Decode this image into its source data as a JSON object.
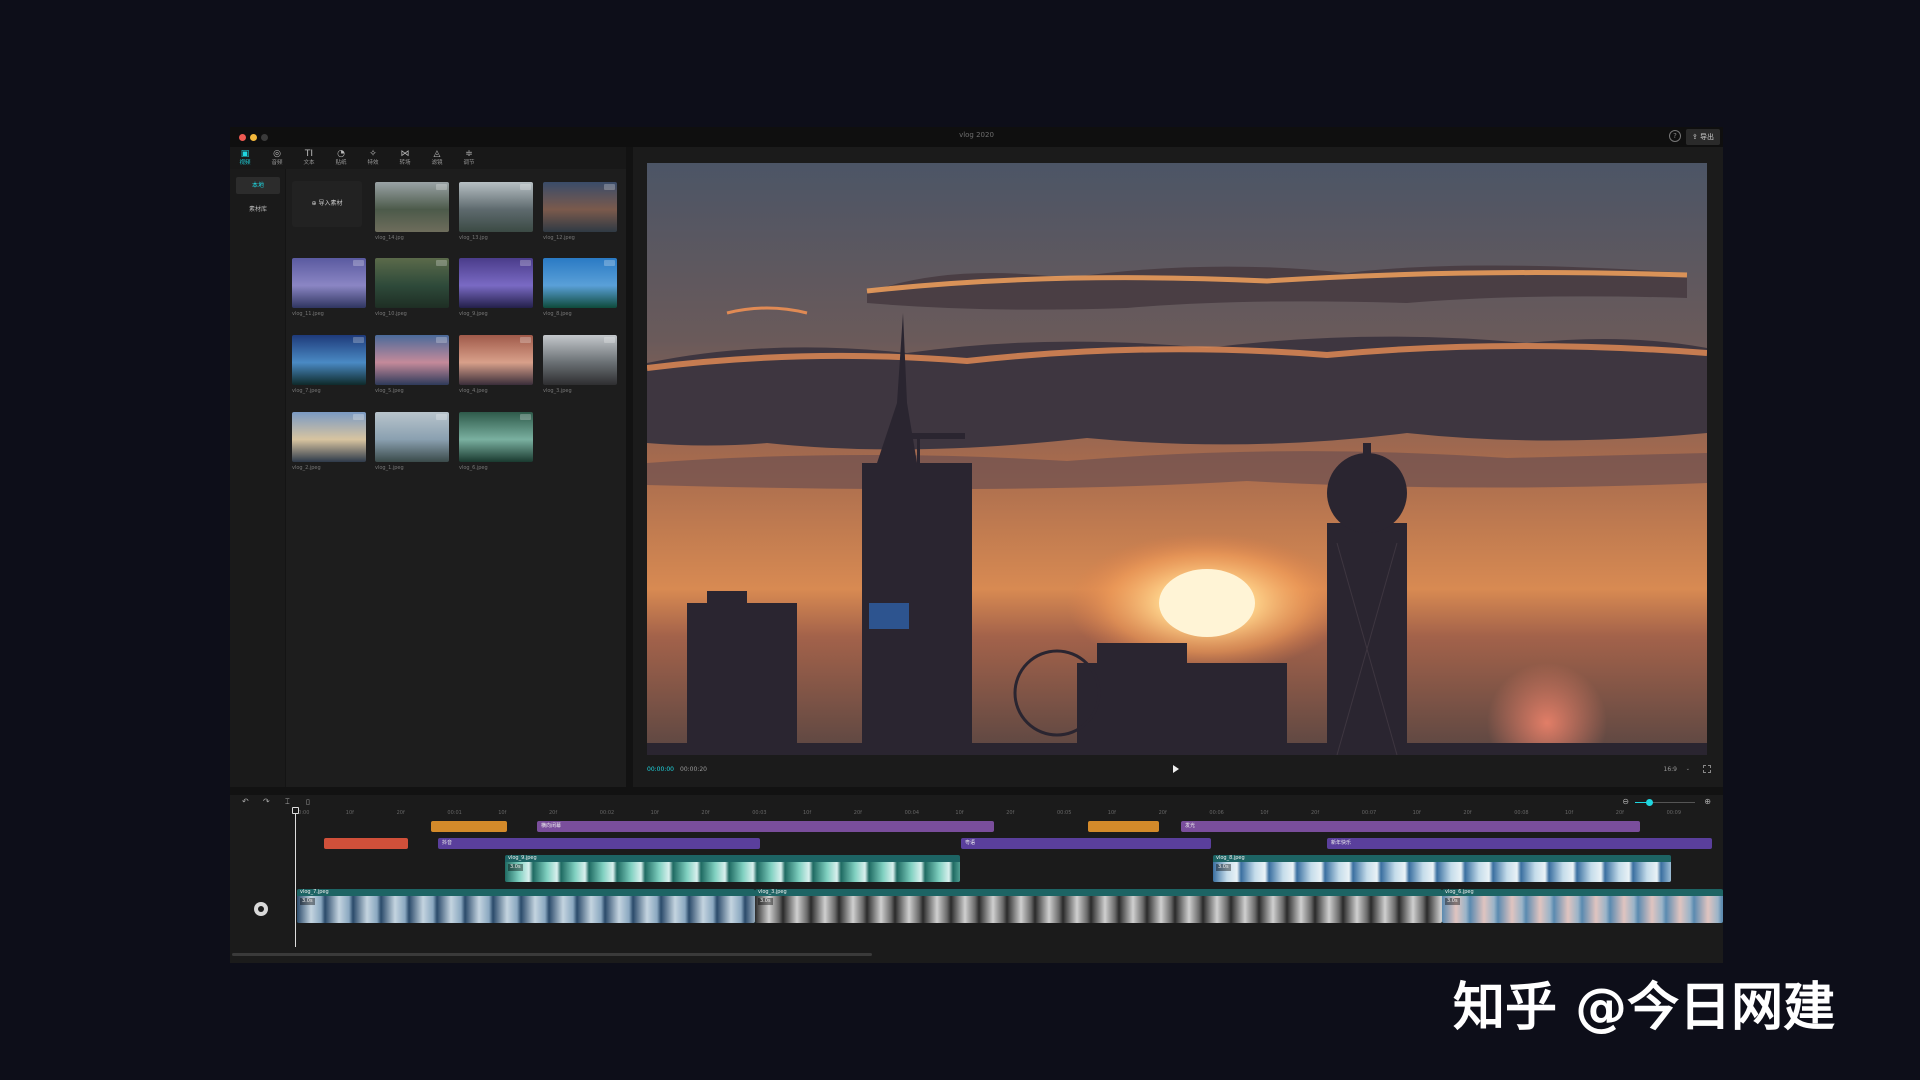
{
  "window": {
    "title": "vlog 2020",
    "export_label": "导出",
    "help_icon": "help-icon"
  },
  "media_tabs": [
    {
      "label": "视频",
      "icon": "video-icon",
      "glyph": "▣",
      "active": true
    },
    {
      "label": "音频",
      "icon": "audio-icon",
      "glyph": "◎",
      "active": false
    },
    {
      "label": "文本",
      "icon": "text-icon",
      "glyph": "TI",
      "active": false
    },
    {
      "label": "贴纸",
      "icon": "sticker-icon",
      "glyph": "◔",
      "active": false
    },
    {
      "label": "特效",
      "icon": "effects-icon",
      "glyph": "✧",
      "active": false
    },
    {
      "label": "转场",
      "icon": "transition-icon",
      "glyph": "⋈",
      "active": false
    },
    {
      "label": "滤镜",
      "icon": "filter-icon",
      "glyph": "◬",
      "active": false
    },
    {
      "label": "调节",
      "icon": "adjust-icon",
      "glyph": "≑",
      "active": false
    }
  ],
  "media_side": {
    "local": "本地",
    "library": "素材库"
  },
  "import_label": "导入素材",
  "media_items": [
    {
      "name": "vlog_14.jpg",
      "colors": [
        "#9aa3a6",
        "#4c5a4a",
        "#6e6d5c"
      ]
    },
    {
      "name": "vlog_13.jpg",
      "colors": [
        "#b7c0c4",
        "#5e6a6e",
        "#3b4a44"
      ]
    },
    {
      "name": "vlog_12.jpeg",
      "colors": [
        "#3a4c6a",
        "#7b5a4c",
        "#2f3a44"
      ]
    },
    {
      "name": "vlog_11.jpeg",
      "colors": [
        "#5a5aa0",
        "#8b86c4",
        "#2f3560"
      ]
    },
    {
      "name": "vlog_10.jpeg",
      "colors": [
        "#5b6a4a",
        "#2e4a3a",
        "#1e2e24"
      ]
    },
    {
      "name": "vlog_9.jpeg",
      "colors": [
        "#4a3c8a",
        "#7a6ac4",
        "#231f4a"
      ]
    },
    {
      "name": "vlog_8.jpeg",
      "colors": [
        "#2a7ac4",
        "#5aa0d8",
        "#0e4a3a"
      ]
    },
    {
      "name": "vlog_7.jpeg",
      "colors": [
        "#1e3a7a",
        "#4a8ac4",
        "#0e2a2a"
      ]
    },
    {
      "name": "vlog_5.jpeg",
      "colors": [
        "#4a6a9a",
        "#c48a9a",
        "#2e3a5a"
      ]
    },
    {
      "name": "vlog_4.jpeg",
      "colors": [
        "#a05a4a",
        "#d8a08a",
        "#3a2e3a"
      ]
    },
    {
      "name": "vlog_3.jpeg",
      "colors": [
        "#c4c8cc",
        "#6a7074",
        "#2e2e30"
      ]
    },
    {
      "name": "vlog_2.jpeg",
      "colors": [
        "#7a9ac4",
        "#d8c4a0",
        "#2e3a4a"
      ]
    },
    {
      "name": "vlog_1.jpeg",
      "colors": [
        "#b8c4cc",
        "#8aa0b0",
        "#3a4a4a"
      ]
    },
    {
      "name": "vlog_6.jpeg",
      "colors": [
        "#2e5a4a",
        "#7ab0a0",
        "#1a3a30"
      ]
    }
  ],
  "player": {
    "current_time": "00:00:00",
    "total_time": "00:00:20",
    "ratio": "16:9"
  },
  "timeline": {
    "tools": [
      "↶",
      "↷",
      "⌶",
      "🗑"
    ],
    "ruler": [
      "00:00",
      "10f",
      "20f",
      "00:01",
      "10f",
      "20f",
      "00:02",
      "10f",
      "20f",
      "00:03",
      "10f",
      "20f",
      "00:04",
      "10f",
      "20f",
      "00:05",
      "10f",
      "20f",
      "00:06",
      "10f",
      "20f",
      "00:07",
      "10f",
      "20f",
      "00:08",
      "10f",
      "20f",
      "00:09"
    ],
    "fx_track": [
      {
        "label": "",
        "color": "#d48a2a"
      },
      {
        "label": "横向闭幕",
        "color": "#7a4e9c"
      },
      {
        "label": "",
        "color": "#d48a2a"
      },
      {
        "label": "发光",
        "color": "#7a4e9c"
      }
    ],
    "text_track": [
      {
        "label": "",
        "color": "#d0503a"
      },
      {
        "label": "抖音",
        "color": "#5a3f9c"
      },
      {
        "label": "粤语",
        "color": "#5a3f9c"
      },
      {
        "label": "新年快乐",
        "color": "#5a3f9c"
      }
    ],
    "overlay_track": [
      {
        "label": "vlog_9.jpeg",
        "duration": "3.0s"
      },
      {
        "label": "vlog_8.jpeg",
        "duration": "3.0s"
      }
    ],
    "main_track": [
      {
        "label": "vlog_7.jpeg",
        "duration": "3.0s"
      },
      {
        "label": "vlog_3.jpeg",
        "duration": "3.0s"
      },
      {
        "label": "vlog_6.jpeg",
        "duration": "3.0s"
      }
    ]
  },
  "watermark": "知乎 @今日网建"
}
